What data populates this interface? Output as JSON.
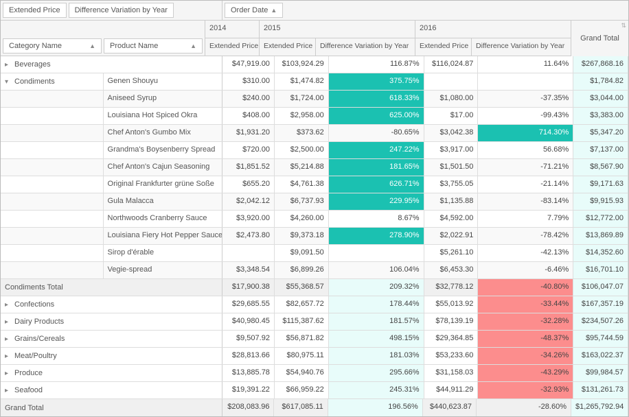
{
  "filters": {
    "extended_price": "Extended Price",
    "diff_var_year": "Difference Variation by Year"
  },
  "col_field": "Order Date",
  "row_fields": {
    "category": "Category Name",
    "product": "Product Name"
  },
  "years": {
    "y2014": "2014",
    "y2015": "2015",
    "y2016": "2016"
  },
  "sub_headers": {
    "extended_price": "Extended Price",
    "diff_var": "Difference Variation by Year",
    "grand_total": "Grand Total"
  },
  "rows": {
    "beverages": {
      "label": "Beverages",
      "ep14": "$47,919.00",
      "ep15": "$103,924.29",
      "dv15": "116.87%",
      "ep16": "$116,024.87",
      "dv16": "11.64%",
      "gt": "$267,868.16"
    },
    "condiments_label": "Condiments",
    "condiments": {
      "genen": {
        "prod": "Genen Shouyu",
        "ep14": "$310.00",
        "ep15": "$1,474.82",
        "dv15": "375.75%",
        "ep16": "",
        "dv16": "",
        "gt": "$1,784.82"
      },
      "aniseed": {
        "prod": "Aniseed Syrup",
        "ep14": "$240.00",
        "ep15": "$1,724.00",
        "dv15": "618.33%",
        "ep16": "$1,080.00",
        "dv16": "-37.35%",
        "gt": "$3,044.00"
      },
      "okra": {
        "prod": "Louisiana Hot Spiced Okra",
        "ep14": "$408.00",
        "ep15": "$2,958.00",
        "dv15": "625.00%",
        "ep16": "$17.00",
        "dv16": "-99.43%",
        "gt": "$3,383.00"
      },
      "gumbo": {
        "prod": "Chef Anton's Gumbo Mix",
        "ep14": "$1,931.20",
        "ep15": "$373.62",
        "dv15": "-80.65%",
        "ep16": "$3,042.38",
        "dv16": "714.30%",
        "gt": "$5,347.20"
      },
      "boysen": {
        "prod": "Grandma's Boysenberry Spread",
        "ep14": "$720.00",
        "ep15": "$2,500.00",
        "dv15": "247.22%",
        "ep16": "$3,917.00",
        "dv16": "56.68%",
        "gt": "$7,137.00"
      },
      "cajun": {
        "prod": "Chef Anton's Cajun Seasoning",
        "ep14": "$1,851.52",
        "ep15": "$5,214.88",
        "dv15": "181.65%",
        "ep16": "$1,501.50",
        "dv16": "-71.21%",
        "gt": "$8,567.90"
      },
      "frank": {
        "prod": "Original Frankfurter grüne Soße",
        "ep14": "$655.20",
        "ep15": "$4,761.38",
        "dv15": "626.71%",
        "ep16": "$3,755.05",
        "dv16": "-21.14%",
        "gt": "$9,171.63"
      },
      "gula": {
        "prod": "Gula Malacca",
        "ep14": "$2,042.12",
        "ep15": "$6,737.93",
        "dv15": "229.95%",
        "ep16": "$1,135.88",
        "dv16": "-83.14%",
        "gt": "$9,915.93"
      },
      "north": {
        "prod": "Northwoods Cranberry Sauce",
        "ep14": "$3,920.00",
        "ep15": "$4,260.00",
        "dv15": "8.67%",
        "ep16": "$4,592.00",
        "dv16": "7.79%",
        "gt": "$12,772.00"
      },
      "fiery": {
        "prod": "Louisiana Fiery Hot Pepper Sauce",
        "ep14": "$2,473.80",
        "ep15": "$9,373.18",
        "dv15": "278.90%",
        "ep16": "$2,022.91",
        "dv16": "-78.42%",
        "gt": "$13,869.89"
      },
      "sirop": {
        "prod": "Sirop d'érable",
        "ep14": "",
        "ep15": "$9,091.50",
        "dv15": "",
        "ep16": "$5,261.10",
        "dv16": "-42.13%",
        "gt": "$14,352.60"
      },
      "vegie": {
        "prod": "Vegie-spread",
        "ep14": "$3,348.54",
        "ep15": "$6,899.26",
        "dv15": "106.04%",
        "ep16": "$6,453.30",
        "dv16": "-6.46%",
        "gt": "$16,701.10"
      }
    },
    "cond_total": {
      "label": "Condiments Total",
      "ep14": "$17,900.38",
      "ep15": "$55,368.57",
      "dv15": "209.32%",
      "ep16": "$32,778.12",
      "dv16": "-40.80%",
      "gt": "$106,047.07"
    },
    "confections": {
      "label": "Confections",
      "ep14": "$29,685.55",
      "ep15": "$82,657.72",
      "dv15": "178.44%",
      "ep16": "$55,013.92",
      "dv16": "-33.44%",
      "gt": "$167,357.19"
    },
    "dairy": {
      "label": "Dairy Products",
      "ep14": "$40,980.45",
      "ep15": "$115,387.62",
      "dv15": "181.57%",
      "ep16": "$78,139.19",
      "dv16": "-32.28%",
      "gt": "$234,507.26"
    },
    "grains": {
      "label": "Grains/Cereals",
      "ep14": "$9,507.92",
      "ep15": "$56,871.82",
      "dv15": "498.15%",
      "ep16": "$29,364.85",
      "dv16": "-48.37%",
      "gt": "$95,744.59"
    },
    "meat": {
      "label": "Meat/Poultry",
      "ep14": "$28,813.66",
      "ep15": "$80,975.11",
      "dv15": "181.03%",
      "ep16": "$53,233.60",
      "dv16": "-34.26%",
      "gt": "$163,022.37"
    },
    "produce": {
      "label": "Produce",
      "ep14": "$13,885.78",
      "ep15": "$54,940.76",
      "dv15": "295.66%",
      "ep16": "$31,158.03",
      "dv16": "-43.29%",
      "gt": "$99,984.57"
    },
    "seafood": {
      "label": "Seafood",
      "ep14": "$19,391.22",
      "ep15": "$66,959.22",
      "dv15": "245.31%",
      "ep16": "$44,911.29",
      "dv16": "-32.93%",
      "gt": "$131,261.73"
    },
    "grand": {
      "label": "Grand Total",
      "ep14": "$208,083.96",
      "ep15": "$617,085.11",
      "dv15": "196.56%",
      "ep16": "$440,623.87",
      "dv16": "-28.60%",
      "gt": "$1,265,792.94"
    }
  }
}
